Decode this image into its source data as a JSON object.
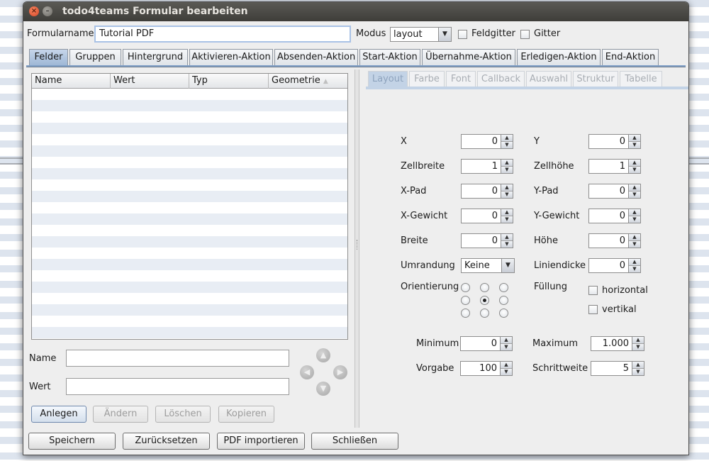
{
  "window": {
    "title": "todo4teams Formular bearbeiten"
  },
  "top": {
    "formname_label": "Formularname",
    "formname_value": "Tutorial PDF",
    "modus_label": "Modus",
    "modus_value": "layout",
    "feldgitter_label": "Feldgitter",
    "gitter_label": "Gitter"
  },
  "tabs": [
    "Felder",
    "Gruppen",
    "Hintergrund",
    "Aktivieren-Aktion",
    "Absenden-Aktion",
    "Start-Aktion",
    "Übernahme-Aktion",
    "Erledigen-Aktion",
    "End-Aktion"
  ],
  "table": {
    "columns": [
      "Name",
      "Wert",
      "Typ",
      "Geometrie"
    ]
  },
  "editor": {
    "name_label": "Name",
    "wert_label": "Wert",
    "name_value": "",
    "wert_value": "",
    "buttons": {
      "anlegen": "Anlegen",
      "aendern": "Ändern",
      "loeschen": "Löschen",
      "kopieren": "Kopieren"
    }
  },
  "subtabs": [
    "Layout",
    "Farbe",
    "Font",
    "Callback",
    "Auswahl",
    "Struktur",
    "Tabelle"
  ],
  "layout": {
    "x_label": "X",
    "x_value": "0",
    "y_label": "Y",
    "y_value": "0",
    "zellbreite_label": "Zellbreite",
    "zellbreite_value": "1",
    "zellhoehe_label": "Zellhöhe",
    "zellhoehe_value": "1",
    "xpad_label": "X-Pad",
    "xpad_value": "0",
    "ypad_label": "Y-Pad",
    "ypad_value": "0",
    "xgewicht_label": "X-Gewicht",
    "xgewicht_value": "0",
    "ygewicht_label": "Y-Gewicht",
    "ygewicht_value": "0",
    "breite_label": "Breite",
    "breite_value": "0",
    "hoehe_label": "Höhe",
    "hoehe_value": "0",
    "umrandung_label": "Umrandung",
    "umrandung_value": "Keine",
    "liniendicke_label": "Liniendicke",
    "liniendicke_value": "0",
    "orientierung_label": "Orientierung",
    "fuellung_label": "Füllung",
    "horizontal_label": "horizontal",
    "vertikal_label": "vertikal",
    "minimum_label": "Minimum",
    "minimum_value": "0",
    "maximum_label": "Maximum",
    "maximum_value": "1.000",
    "vorgabe_label": "Vorgabe",
    "vorgabe_value": "100",
    "schrittweite_label": "Schrittweite",
    "schrittweite_value": "5"
  },
  "bottom_buttons": {
    "speichern": "Speichern",
    "zuruecksetzen": "Zurücksetzen",
    "pdf_importieren": "PDF importieren",
    "schliessen": "Schließen"
  }
}
